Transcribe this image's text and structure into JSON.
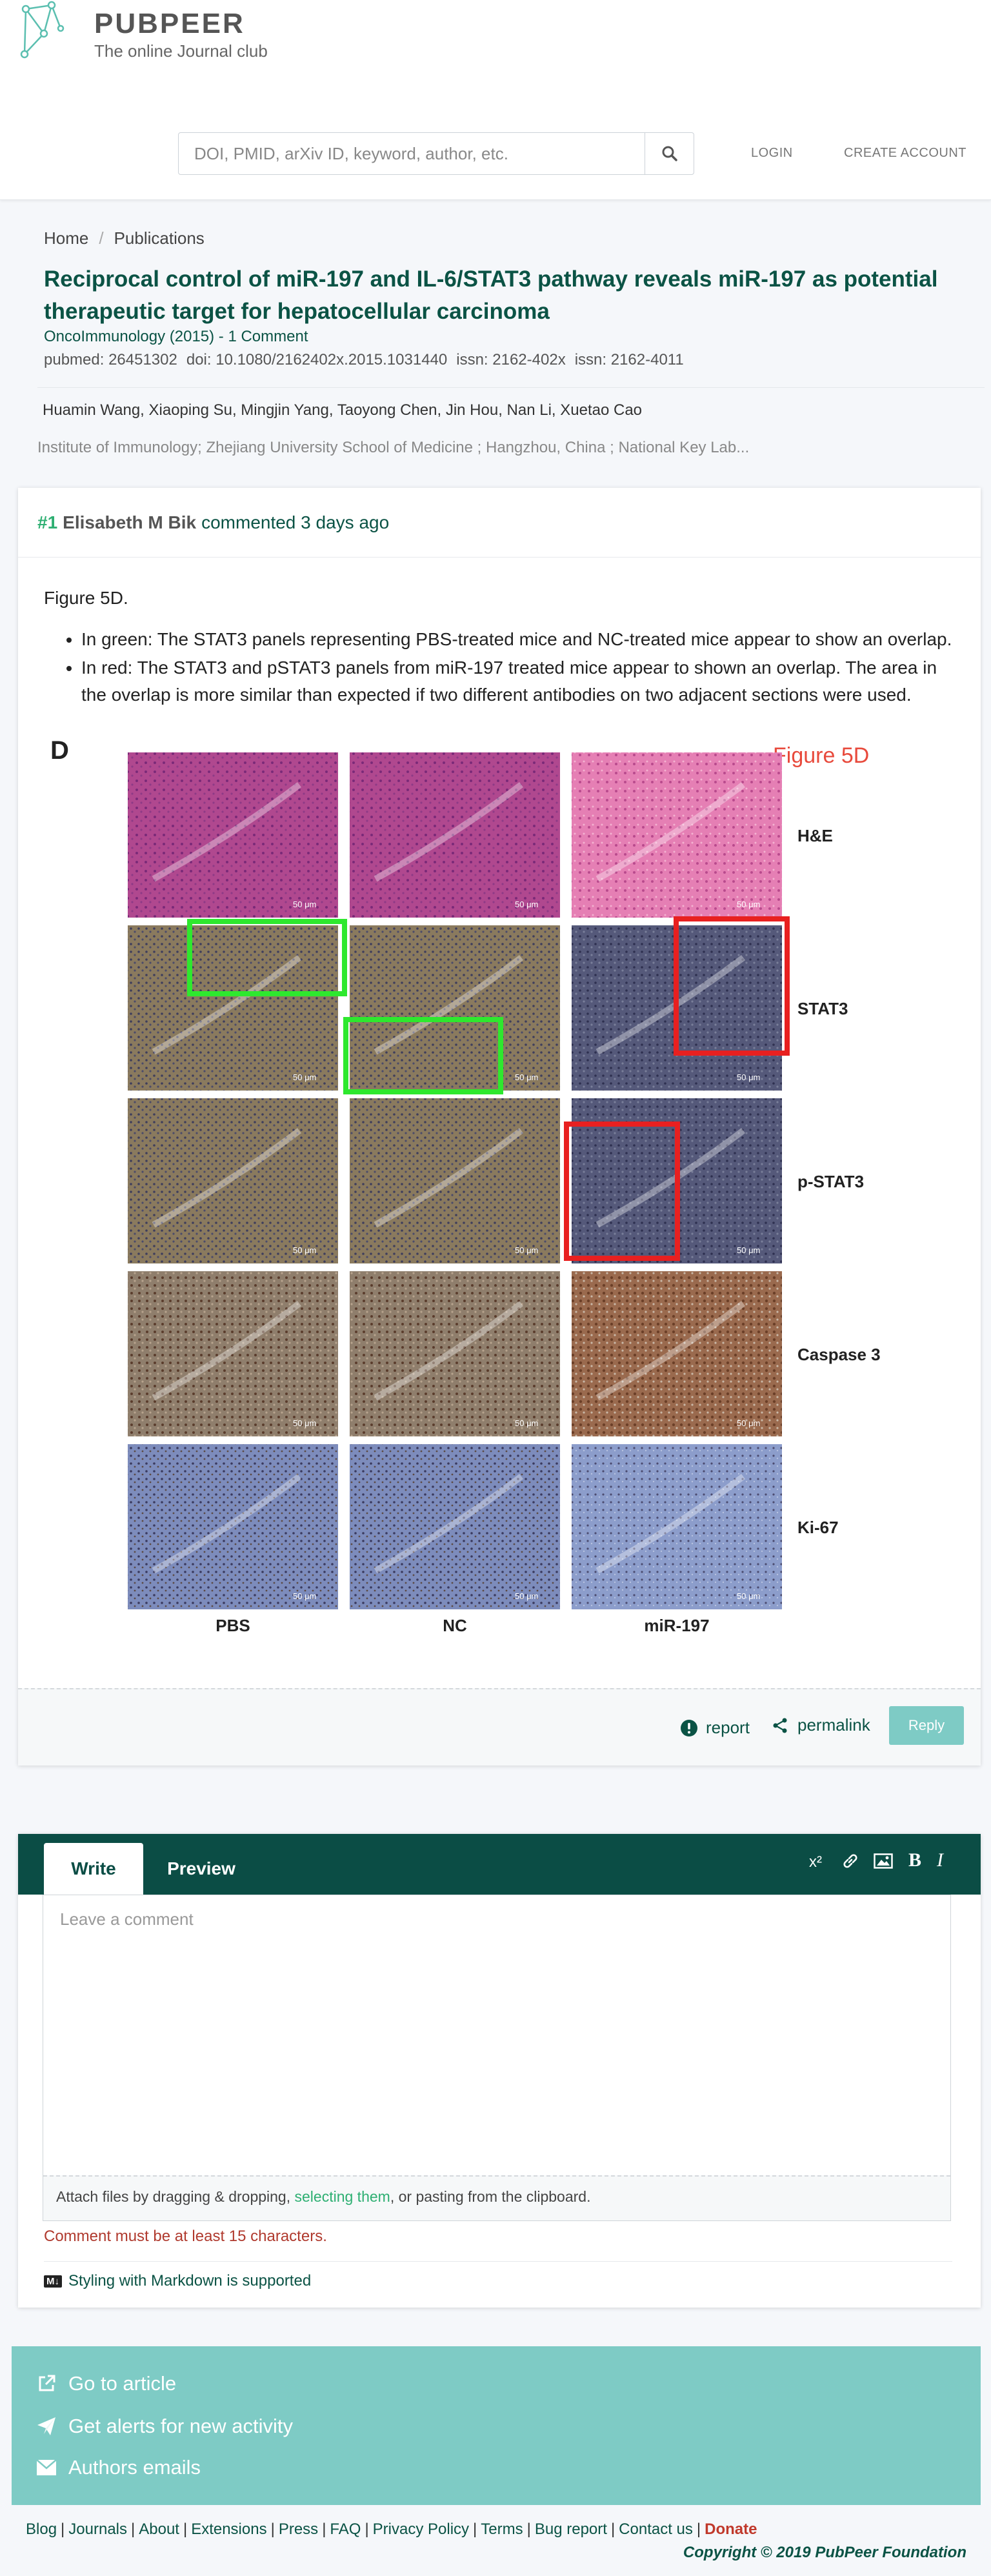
{
  "brand": {
    "name": "PUBPEER",
    "tagline": "The online Journal club"
  },
  "search": {
    "placeholder": "DOI, PMID, arXiv ID, keyword, author, etc."
  },
  "nav": {
    "login": "LOGIN",
    "create_account": "CREATE ACCOUNT"
  },
  "breadcrumb": [
    "Home",
    "Publications"
  ],
  "publication": {
    "title": "Reciprocal control of miR-197 and IL-6/STAT3 pathway reveals miR-197 as potential therapeutic target for hepatocellular carcinoma",
    "journal_line": "OncoImmunology (2015) - 1 Comment",
    "pubmed": "pubmed: 26451302",
    "doi": "doi: 10.1080/2162402x.2015.1031440",
    "issn1": "issn: 2162-402x",
    "issn2": "issn: 2162-4011",
    "authors": "Huamin Wang, Xiaoping Su, Mingjin Yang, Taoyong Chen, Jin Hou, Nan Li, Xuetao Cao",
    "institution": "Institute of Immunology; Zhejiang University School of Medicine ; Hangzhou, China ; National Key Lab..."
  },
  "comment": {
    "number": "#1",
    "author": "Elisabeth M Bik",
    "when": "commented 3 days ago",
    "intro": "Figure 5D.",
    "bullets": [
      "In green: The STAT3 panels representing PBS-treated mice and NC-treated mice appear to show an overlap.",
      "In red: The STAT3 and pSTAT3 panels from miR-197 treated mice appear to shown an overlap. The area in the overlap is more similar than expected if two different antibodies on two adjacent sections were used."
    ],
    "figure": {
      "panel_letter": "D",
      "caption": "Figure 5D",
      "rows": [
        "H&E",
        "STAT3",
        "p-STAT3",
        "Caspase 3",
        "Ki-67"
      ],
      "cols": [
        "PBS",
        "NC",
        "miR-197"
      ],
      "scale": "50 μm"
    },
    "report": "report",
    "permalink": "permalink",
    "reply": "Reply"
  },
  "editor": {
    "tab_write": "Write",
    "tab_preview": "Preview",
    "superscript": "x²",
    "bold": "B",
    "italic": "I",
    "placeholder": "Leave a comment",
    "attach_prefix": "Attach files by dragging & dropping, ",
    "attach_link": "selecting them",
    "attach_suffix": ", or pasting from the clipboard.",
    "error": "Comment must be at least 15 characters.",
    "markdown_badge": "M↓",
    "markdown": "Styling with Markdown is supported"
  },
  "actions": [
    "Go to article",
    "Get alerts for new activity",
    "Authors emails"
  ],
  "footer": {
    "links": [
      "Blog",
      "Journals",
      "About",
      "Extensions",
      "Press",
      "FAQ",
      "Privacy Policy",
      "Terms",
      "Bug report",
      "Contact us"
    ],
    "donate": "Donate",
    "copyright": "Copyright © 2019 PubPeer Foundation"
  },
  "colors": {
    "brand_green": "#0b5345",
    "accent_green": "#2eaf72",
    "teal": "#7ecbc5",
    "editor_bar": "#0b4d45",
    "error": "#b03a2e"
  }
}
